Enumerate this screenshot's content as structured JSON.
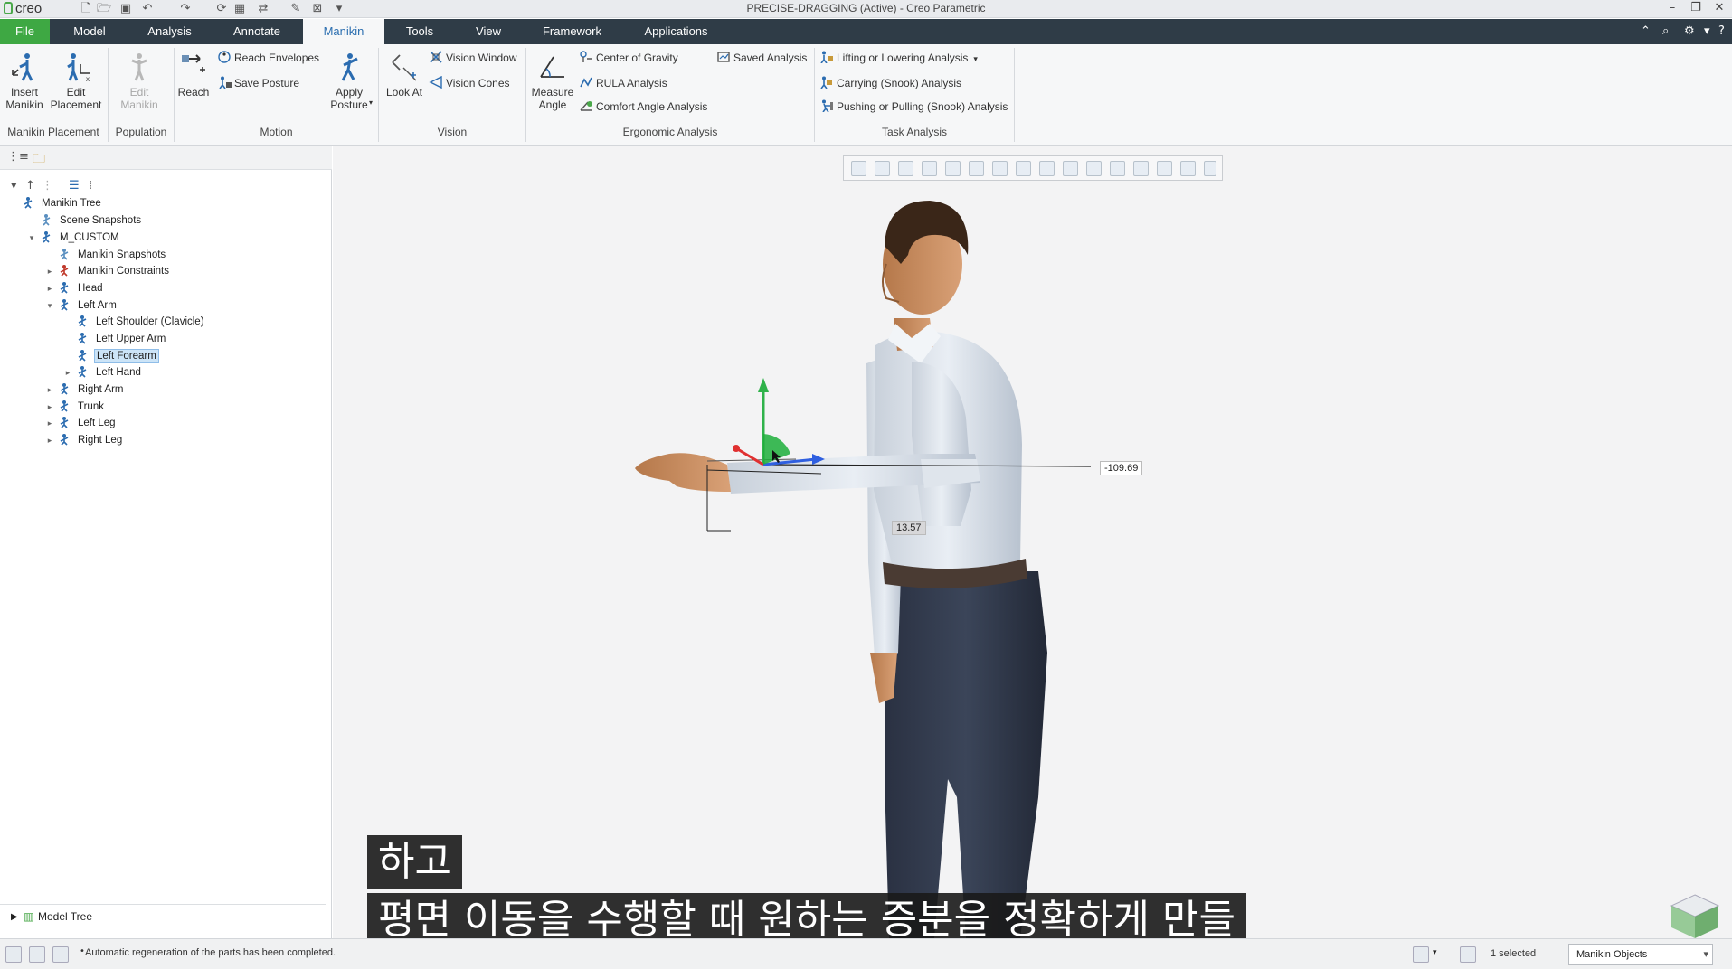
{
  "app": {
    "logo": "creo",
    "window_title": "PRECISE-DRAGGING (Active) - Creo Parametric"
  },
  "quick_access": [
    "new-icon",
    "open-icon",
    "save-icon",
    "undo-icon",
    "redo-icon",
    "regenerate-icon",
    "windows-icon",
    "close-window-icon",
    "customize-icon"
  ],
  "tabs": [
    {
      "label": "File"
    },
    {
      "label": "Model"
    },
    {
      "label": "Analysis"
    },
    {
      "label": "Annotate"
    },
    {
      "label": "Manikin",
      "active": true
    },
    {
      "label": "Tools"
    },
    {
      "label": "View"
    },
    {
      "label": "Framework"
    },
    {
      "label": "Applications"
    }
  ],
  "ribbon": {
    "manikin_placement": {
      "group_label": "Manikin Placement",
      "insert_manikin": "Insert\nManikin",
      "edit_placement": "Edit\nPlacement"
    },
    "population": {
      "group_label": "Population",
      "edit_manikin": "Edit\nManikin"
    },
    "motion": {
      "group_label": "Motion",
      "reach": "Reach",
      "reach_envelopes": "Reach Envelopes",
      "save_posture": "Save Posture",
      "apply_posture": "Apply\nPosture"
    },
    "vision": {
      "group_label": "Vision",
      "look_at": "Look At",
      "vision_window": "Vision Window",
      "vision_cones": "Vision Cones"
    },
    "ergonomic": {
      "group_label": "Ergonomic Analysis",
      "measure_angle": "Measure\nAngle",
      "center_of_gravity": "Center of Gravity",
      "rula_analysis": "RULA Analysis",
      "comfort_angle": "Comfort Angle Analysis",
      "saved_analysis": "Saved Analysis"
    },
    "task": {
      "group_label": "Task Analysis",
      "lifting": "Lifting or Lowering Analysis",
      "carrying": "Carrying (Snook) Analysis",
      "pushing": "Pushing or Pulling (Snook) Analysis"
    }
  },
  "tree": {
    "items": [
      {
        "label": "Manikin Tree"
      },
      {
        "label": "Scene Snapshots"
      },
      {
        "label": "M_CUSTOM"
      },
      {
        "label": "Manikin Snapshots"
      },
      {
        "label": "Manikin Constraints"
      },
      {
        "label": "Head"
      },
      {
        "label": "Left Arm"
      },
      {
        "label": "Left Shoulder (Clavicle)"
      },
      {
        "label": "Left Upper Arm"
      },
      {
        "label": "Left Forearm",
        "selected": true
      },
      {
        "label": "Left Hand"
      },
      {
        "label": "Right Arm"
      },
      {
        "label": "Trunk"
      },
      {
        "label": "Left Leg"
      },
      {
        "label": "Right Leg"
      }
    ],
    "model_tree_label": "Model Tree"
  },
  "viewport": {
    "dim_horizontal": "-109.69",
    "dim_vertical": "13.57",
    "subtitle_line1": "하고",
    "subtitle_line2": "평면 이동을 수행할 때 원하는 증분을 정확하게 만들"
  },
  "statusbar": {
    "message": "Automatic regeneration of the parts has been completed.",
    "selected": "1 selected",
    "filter": "Manikin Objects"
  },
  "colors": {
    "file_tab": "#3ea843",
    "tab_bar": "#2f3c47",
    "active_tab_text": "#2c6fb0",
    "selection": "#cce4f7"
  }
}
